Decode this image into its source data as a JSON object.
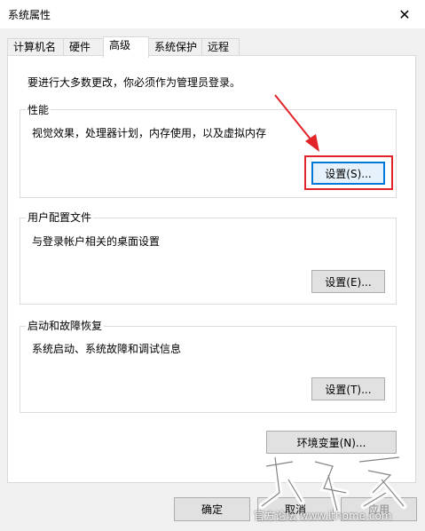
{
  "window": {
    "title": "系统属性",
    "close_icon": "close-icon"
  },
  "tabs": [
    {
      "label": "计算机名"
    },
    {
      "label": "硬件"
    },
    {
      "label": "高级",
      "active": true
    },
    {
      "label": "系统保护"
    },
    {
      "label": "远程"
    }
  ],
  "notice": "要进行大多数更改，你必须作为管理员登录。",
  "performance": {
    "title": "性能",
    "description": "视觉效果，处理器计划，内存使用，以及虚拟内存",
    "button": "设置(S)..."
  },
  "user_profiles": {
    "title": "用户配置文件",
    "description": "与登录帐户相关的桌面设置",
    "button": "设置(E)..."
  },
  "startup_recovery": {
    "title": "启动和故障恢复",
    "description": "系统启动、系统故障和调试信息",
    "button": "设置(T)..."
  },
  "env_button": "环境变量(N)...",
  "footer": {
    "ok": "确定",
    "cancel": "取消",
    "apply": "应用"
  },
  "watermark": {
    "text": "官方论坛 www.ithome.com"
  },
  "colors": {
    "annotation_red": "#e0242a",
    "focus_blue": "#0078d7"
  }
}
